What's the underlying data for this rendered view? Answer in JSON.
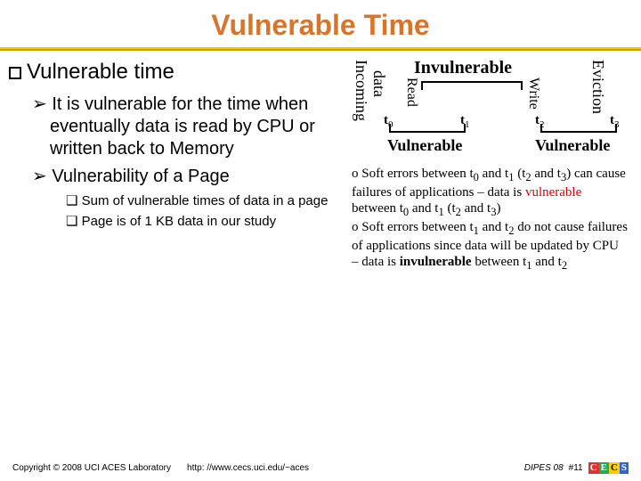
{
  "title": "Vulnerable Time",
  "left": {
    "h1": "Vulnerable time",
    "b1": "It is vulnerable for the time when eventually data is read by CPU or written back to Memory",
    "b2": "Vulnerability of a Page",
    "s1": "Sum of vulnerable times of data in a page",
    "s2": "Page is of 1 KB data in our study"
  },
  "diag": {
    "incoming": "Incoming",
    "data": "data",
    "invuln": "Invulnerable",
    "read": "Read",
    "write": "Write",
    "eviction": "Eviction",
    "t0": "t",
    "t0s": "0",
    "t1": "t",
    "t1s": "1",
    "t2": "t",
    "t2s": "2",
    "t3": "t",
    "t3s": "3",
    "vuln": "Vulnerable"
  },
  "notes": {
    "n1a": "Soft errors between t",
    "n1b": " and t",
    "n1c": " (t",
    "n1d": " and t",
    "n1e": ") can cause failures of applications – data is ",
    "n1f": "vulnerable",
    "n1g": " between t",
    "n1h": " and t",
    "n1i": " (t",
    "n1j": " and t",
    "n1k": ")",
    "n2a": "Soft errors between t",
    "n2b": " and t",
    "n2c": " do not cause failures of applications since data will be updated by CPU – data is ",
    "n2d": "invulnerable",
    "n2e": " between t",
    "n2f": " and t"
  },
  "footer": {
    "copy": "Copyright © 2008  UCI ACES Laboratory",
    "url": "http: //www.cecs.uci.edu/~aces",
    "conf": "DIPES 08",
    "page": "#11"
  }
}
